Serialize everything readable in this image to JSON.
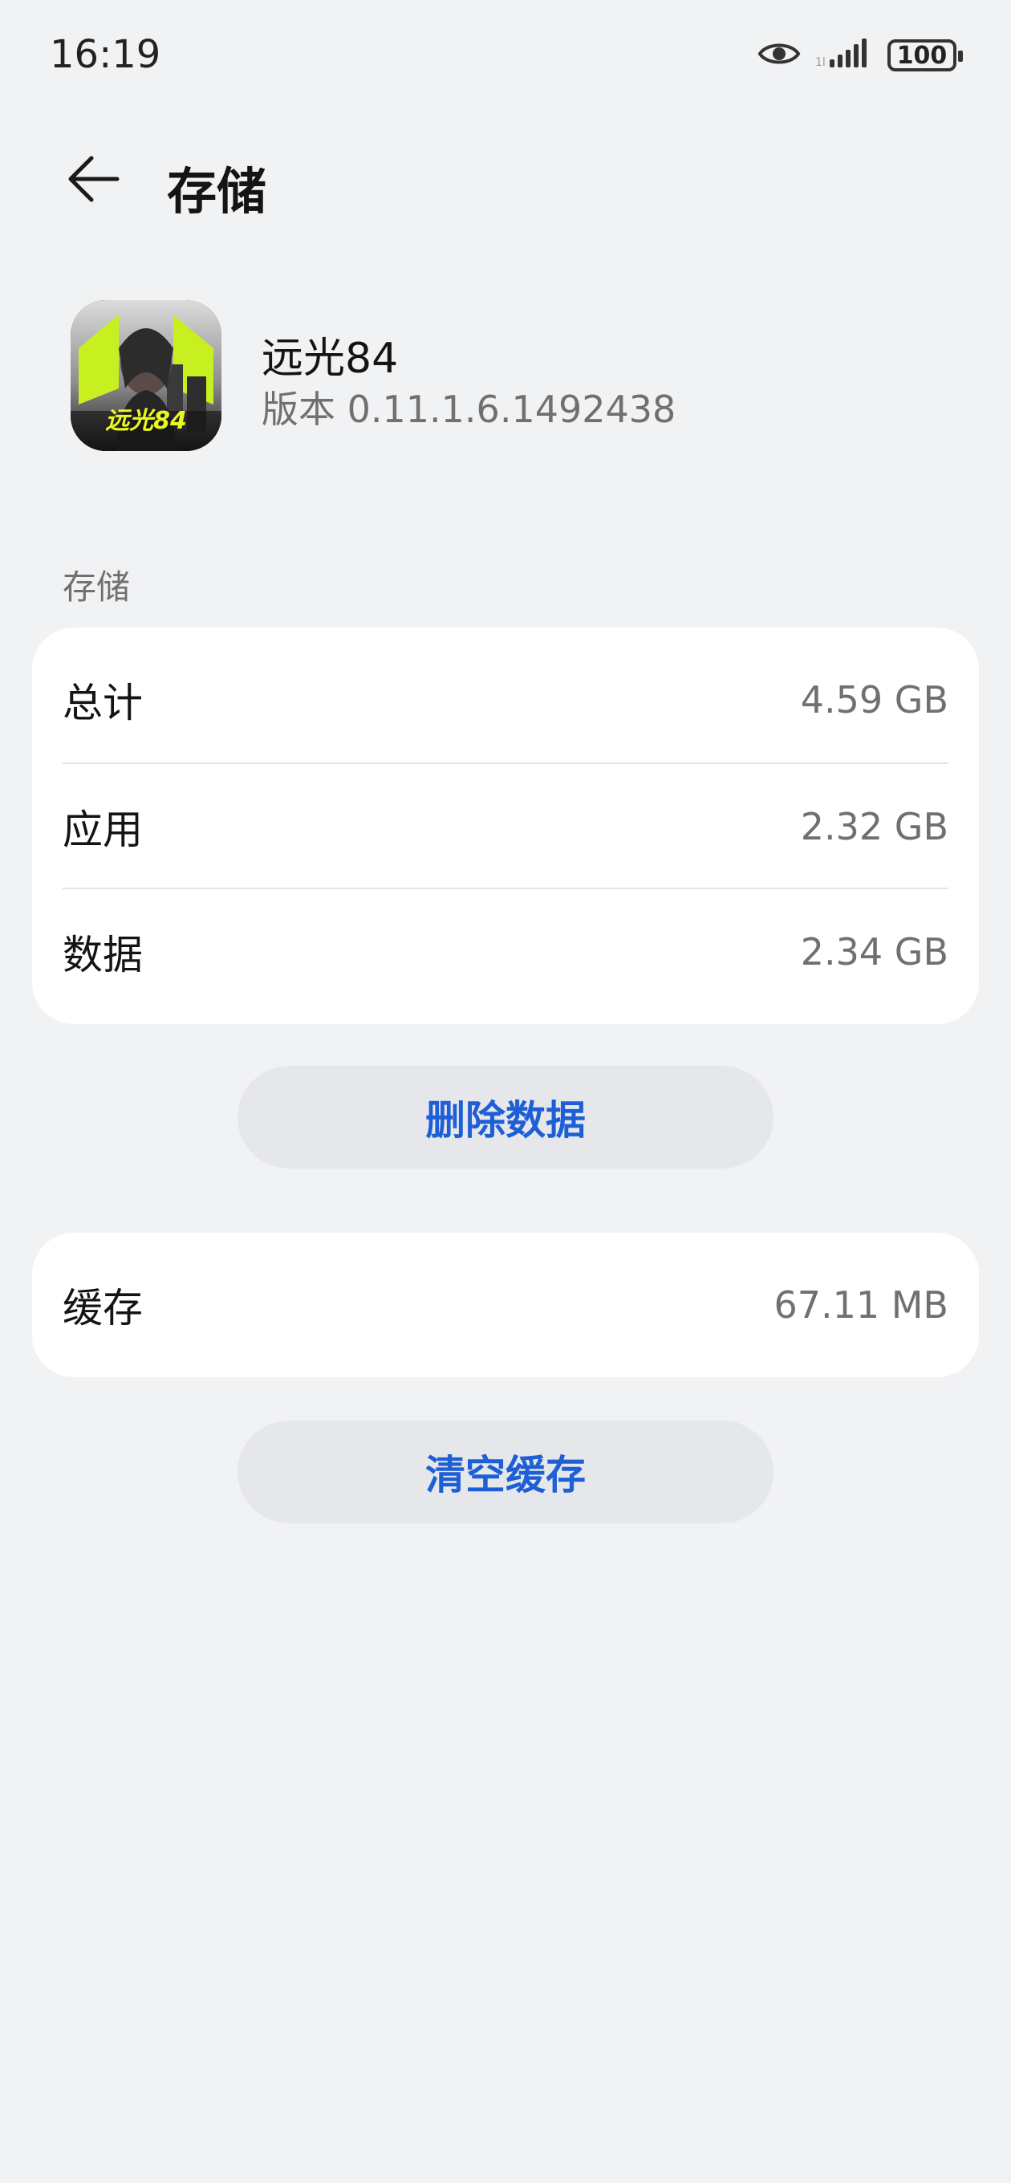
{
  "status_bar": {
    "time": "16:19",
    "battery": "100",
    "icons": [
      "eye-icon",
      "signal-icon",
      "battery-icon"
    ]
  },
  "header": {
    "title": "存储",
    "back_icon": "arrow-left-icon"
  },
  "app": {
    "name": "远光84",
    "version": "版本 0.11.1.6.1492438",
    "icon_text": "远光84"
  },
  "storage": {
    "section_label": "存储",
    "rows": [
      {
        "label": "总计",
        "value": "4.59 GB"
      },
      {
        "label": "应用",
        "value": "2.32 GB"
      },
      {
        "label": "数据",
        "value": "2.34 GB"
      }
    ],
    "delete_button": "删除数据"
  },
  "cache": {
    "label": "缓存",
    "value": "67.11 MB",
    "clear_button": "清空缓存"
  },
  "colors": {
    "background": "#f1f2f4",
    "card": "#ffffff",
    "accent": "#1f5fd6",
    "button_bg": "#e6e7ea",
    "secondary_text": "#707070"
  }
}
